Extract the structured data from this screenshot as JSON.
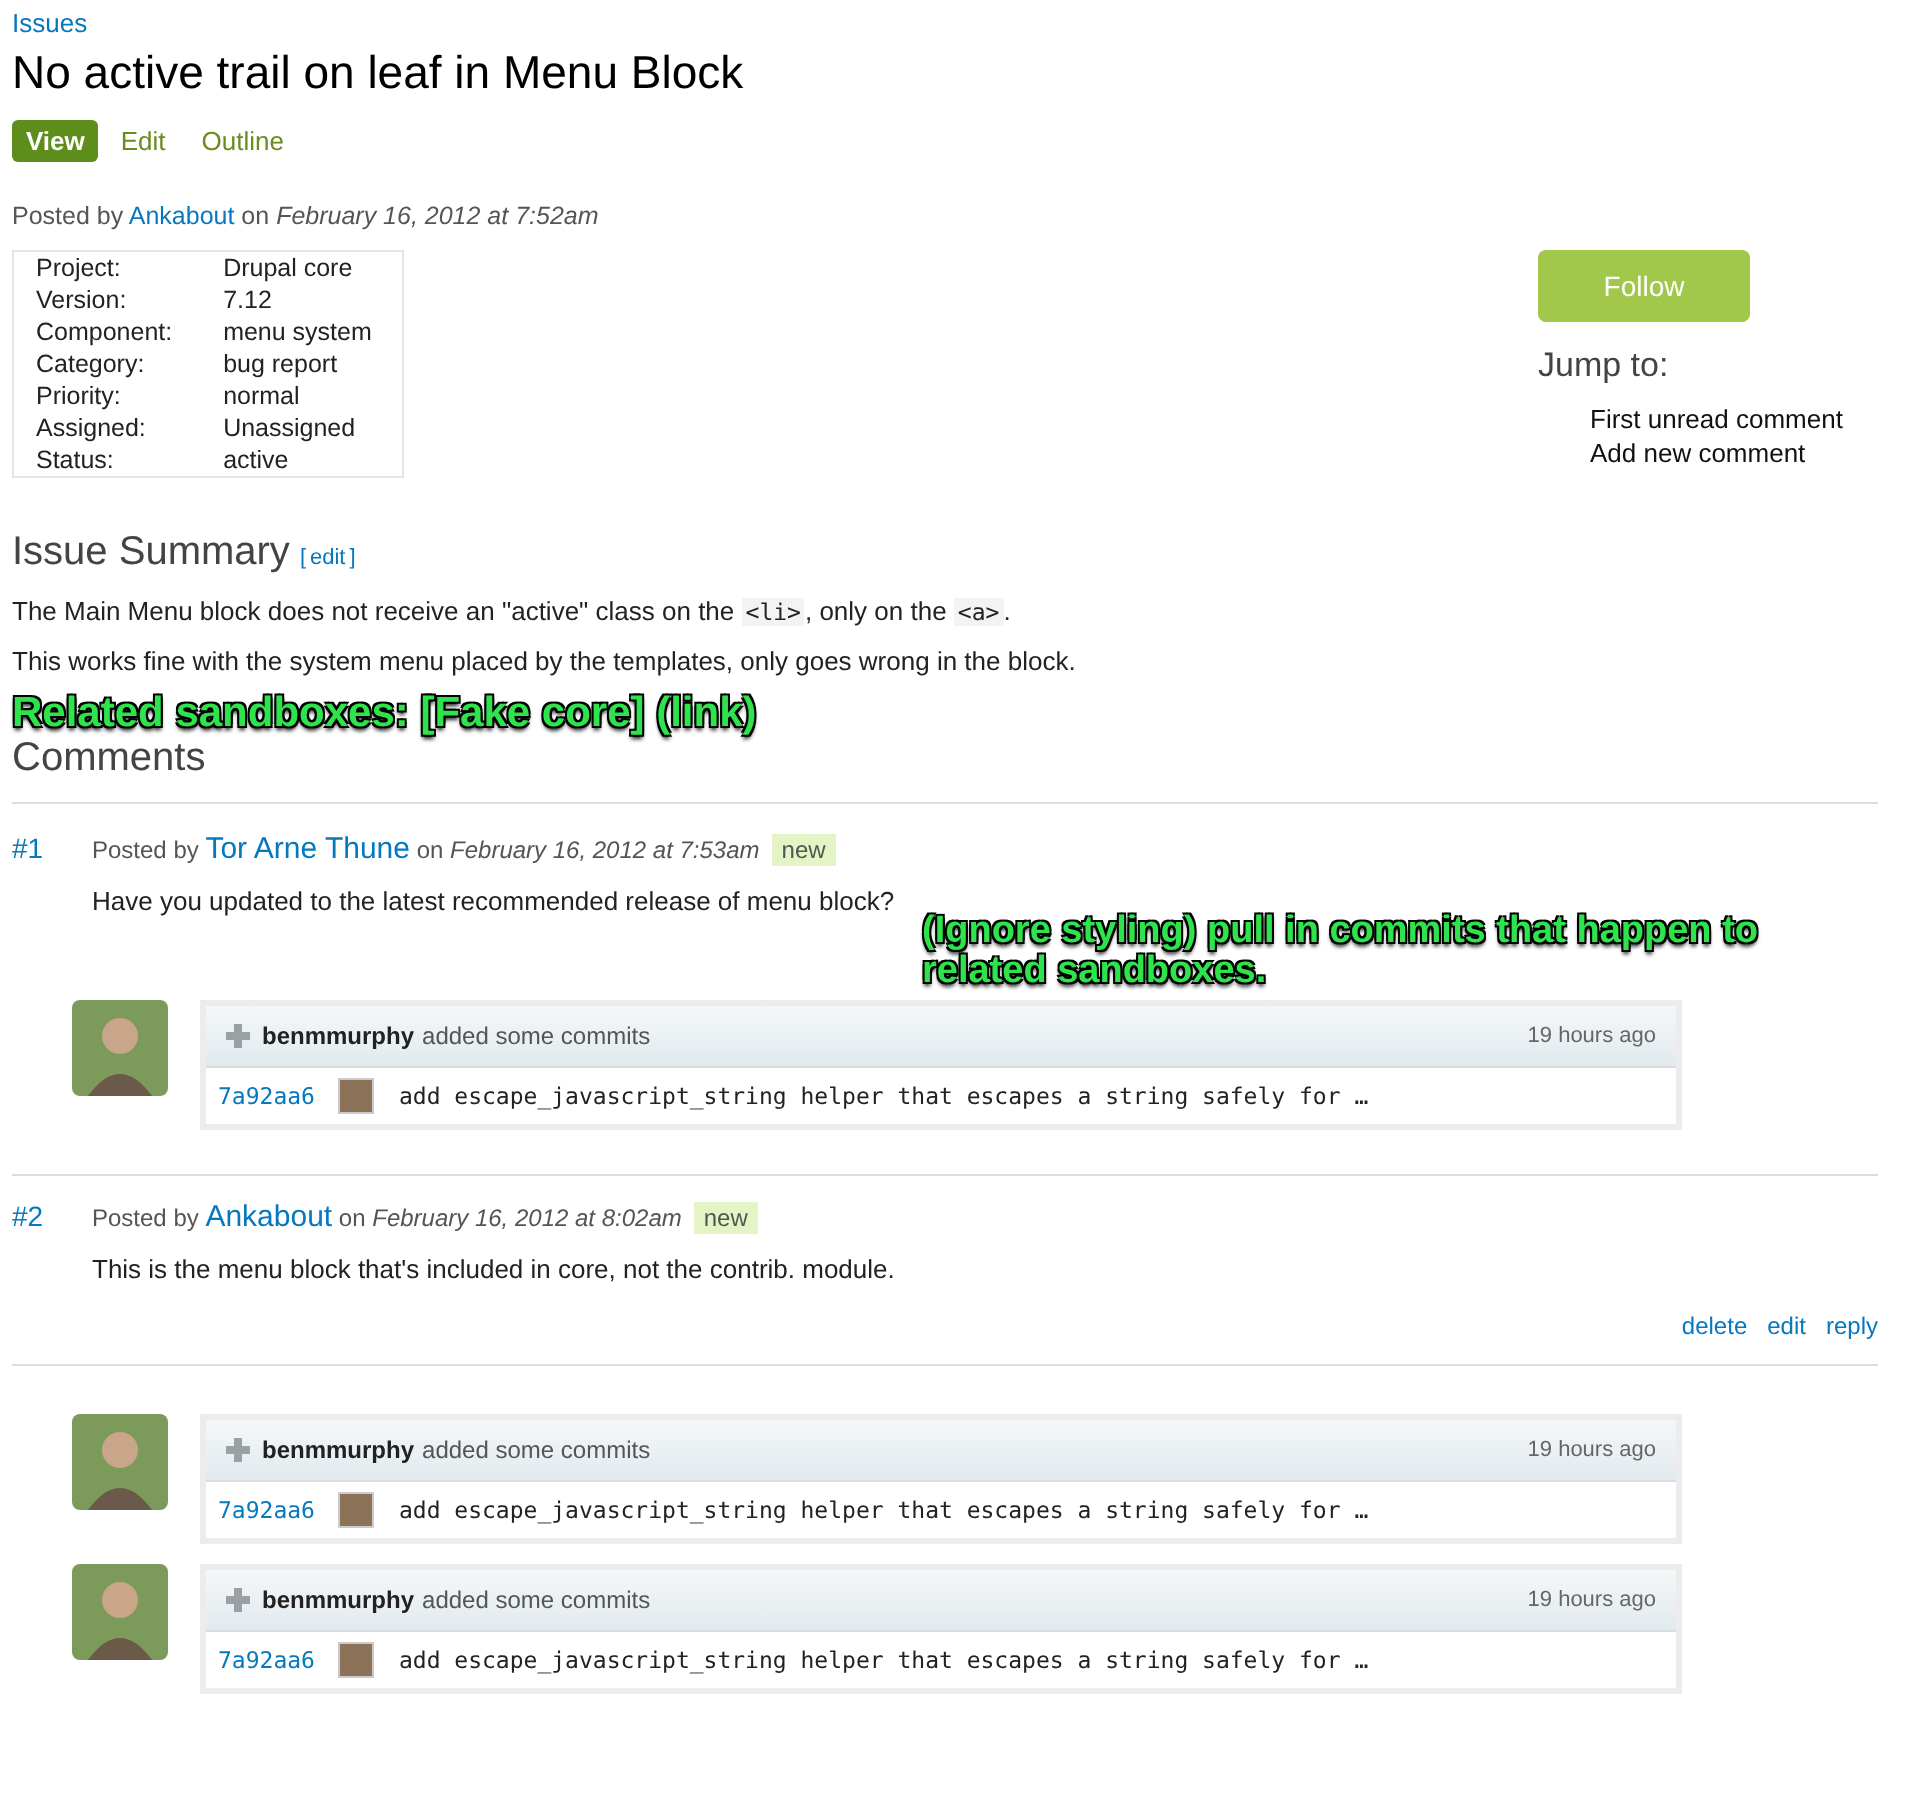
{
  "breadcrumb": "Issues",
  "title": "No active trail on leaf in Menu Block",
  "tabs": [
    {
      "label": "View",
      "selected": true
    },
    {
      "label": "Edit",
      "selected": false
    },
    {
      "label": "Outline",
      "selected": false
    }
  ],
  "posted": {
    "prefix": "Posted by",
    "author": "Ankabout",
    "on": "on",
    "date": "February 16, 2012 at 7:52am"
  },
  "meta": [
    {
      "label": "Project:",
      "value": "Drupal core"
    },
    {
      "label": "Version:",
      "value": "7.12"
    },
    {
      "label": "Component:",
      "value": "menu system"
    },
    {
      "label": "Category:",
      "value": "bug report"
    },
    {
      "label": "Priority:",
      "value": "normal"
    },
    {
      "label": "Assigned:",
      "value": "Unassigned"
    },
    {
      "label": "Status:",
      "value": "active"
    }
  ],
  "sidebar": {
    "follow_button": "Follow",
    "jump_heading": "Jump to:",
    "jump_links": [
      "First unread comment",
      "Add new comment"
    ]
  },
  "summary": {
    "heading": "Issue Summary",
    "edit_open": "[",
    "edit_link": "edit",
    "edit_close": "]",
    "paragraphs": [
      [
        {
          "text": "The Main Menu block does not receive an \"active\" class on the ",
          "code": false
        },
        {
          "text": "<li>",
          "code": true
        },
        {
          "text": ", only on the ",
          "code": false
        },
        {
          "text": "<a>",
          "code": true
        },
        {
          "text": ".",
          "code": false
        }
      ],
      [
        {
          "text": "This works fine with the system menu placed by the templates, only goes wrong in the block.",
          "code": false
        }
      ]
    ]
  },
  "annotations": [
    "Related sandboxes: [Fake core] (link)",
    "(Ignore styling) pull in commits that happen to related sandboxes."
  ],
  "comments_heading": "Comments",
  "comments": [
    {
      "number": "#1",
      "prefix": "Posted by",
      "author": "Tor Arne Thune",
      "on": "on",
      "date": "February 16, 2012 at 7:53am",
      "badge": "new",
      "body": "Have you updated to the latest recommended release of menu block?",
      "commits": [
        {
          "user": "benmmurphy",
          "action": "added some commits",
          "time": "19 hours ago",
          "hash": "7a92aa6",
          "message": "add escape_javascript_string helper that escapes a string safely for …"
        }
      ]
    },
    {
      "number": "#2",
      "prefix": "Posted by",
      "author": "Ankabout",
      "on": "on",
      "date": "February 16, 2012 at 8:02am",
      "badge": "new",
      "body": "This is the menu block that's included in core, not the contrib. module.",
      "actions": [
        "delete",
        "edit",
        "reply"
      ]
    }
  ],
  "commit_feed": [
    {
      "user": "benmmurphy",
      "action": "added some commits",
      "time": "19 hours ago",
      "hash": "7a92aa6",
      "message": "add escape_javascript_string helper that escapes a string safely for …"
    },
    {
      "user": "benmmurphy",
      "action": "added some commits",
      "time": "19 hours ago",
      "hash": "7a92aa6",
      "message": "add escape_javascript_string helper that escapes a string safely for …"
    }
  ]
}
